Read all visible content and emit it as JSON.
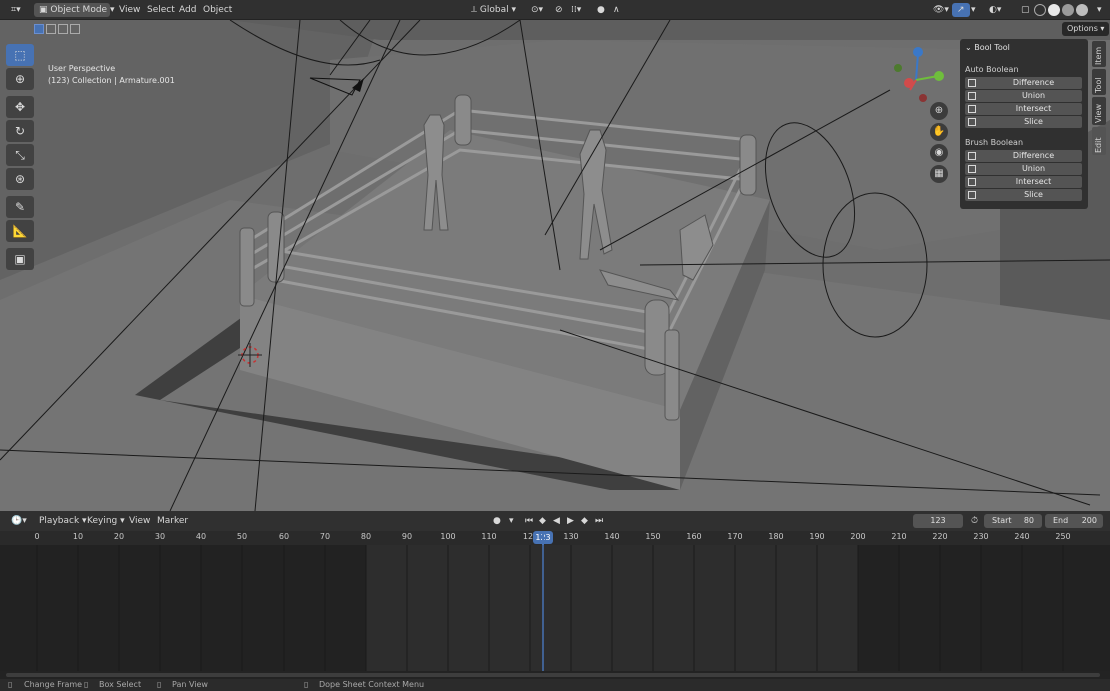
{
  "header": {
    "mode": "Object Mode",
    "menus": [
      "View",
      "Select",
      "Add",
      "Object"
    ],
    "transform_orientation": "Global",
    "options": "Options"
  },
  "viewport": {
    "perspective": "User Perspective",
    "collection": "(123) Collection | Armature.001"
  },
  "toolbar": {
    "tools": [
      "select-box-icon",
      "cursor-icon",
      "move-icon",
      "rotate-icon",
      "scale-icon",
      "transform-icon",
      "annotate-icon",
      "measure-icon",
      "add-cube-icon"
    ]
  },
  "npanel": {
    "title": "Bool Tool",
    "auto_boolean_label": "Auto Boolean",
    "brush_boolean_label": "Brush Boolean",
    "auto_buttons": [
      "Difference",
      "Union",
      "Intersect",
      "Slice"
    ],
    "brush_buttons": [
      "Difference",
      "Union",
      "Intersect",
      "Slice"
    ],
    "tabs": [
      "Item",
      "Tool",
      "View",
      "Edit"
    ]
  },
  "timeline": {
    "menus": [
      "Playback",
      "Keying",
      "View",
      "Marker"
    ],
    "current_frame": "123",
    "start_label": "Start",
    "start_value": "80",
    "end_label": "End",
    "end_value": "200",
    "ruler": [
      "0",
      "10",
      "20",
      "30",
      "40",
      "50",
      "60",
      "70",
      "80",
      "90",
      "100",
      "110",
      "12",
      "130",
      "140",
      "150",
      "160",
      "170",
      "180",
      "190",
      "200",
      "210",
      "220",
      "230",
      "240",
      "250"
    ],
    "playhead_label": "123"
  },
  "statusbar": {
    "items": [
      "Change Frame",
      "Box Select",
      "Pan View",
      "Dope Sheet Context Menu"
    ]
  },
  "colors": {
    "accent": "#4772b3",
    "viewport_bg": "#6e6e6e",
    "panel_bg": "#303030"
  }
}
